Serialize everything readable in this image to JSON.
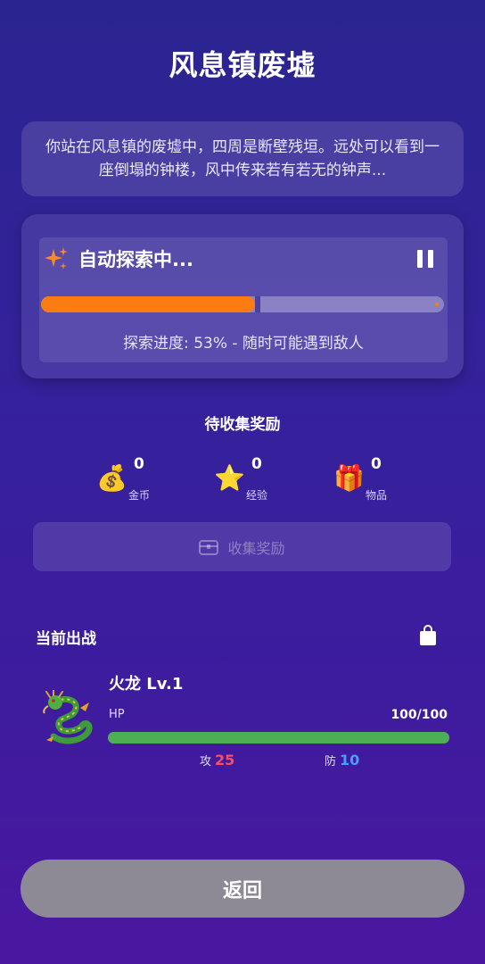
{
  "page": {
    "title": "风息镇废墟"
  },
  "description": "你站在风息镇的废墟中，四周是断壁残垣。远处可以看到一座倒塌的钟楼，风中传来若有若无的钟声...",
  "exploration": {
    "title": "自动探索中...",
    "progress": 0.53,
    "status_text": "探索进度: 53% - 随时可能遇到敌人",
    "colors": {
      "fill": "#fb7c11"
    }
  },
  "rewards": {
    "title": "待收集奖励",
    "items": [
      {
        "icon": "money-bag-icon",
        "emoji": "💰",
        "count": "0",
        "label": "金币"
      },
      {
        "icon": "star-icon",
        "emoji": "⭐",
        "count": "0",
        "label": "经验"
      },
      {
        "icon": "gift-icon",
        "emoji": "🎁",
        "count": "0",
        "label": "物品"
      }
    ],
    "collect_label": "收集奖励"
  },
  "active_pet": {
    "section_title": "当前出战",
    "name": "火龙 Lv.1",
    "hp_label": "HP",
    "hp_text": "100/100",
    "hp_fraction": 1.0,
    "attack_label": "攻",
    "attack": "25",
    "defense_label": "防",
    "defense": "10",
    "colors": {
      "hp": "#4caf55",
      "attack": "#ff4d5e",
      "defense": "#3fa2ff"
    }
  },
  "back_label": "返回"
}
